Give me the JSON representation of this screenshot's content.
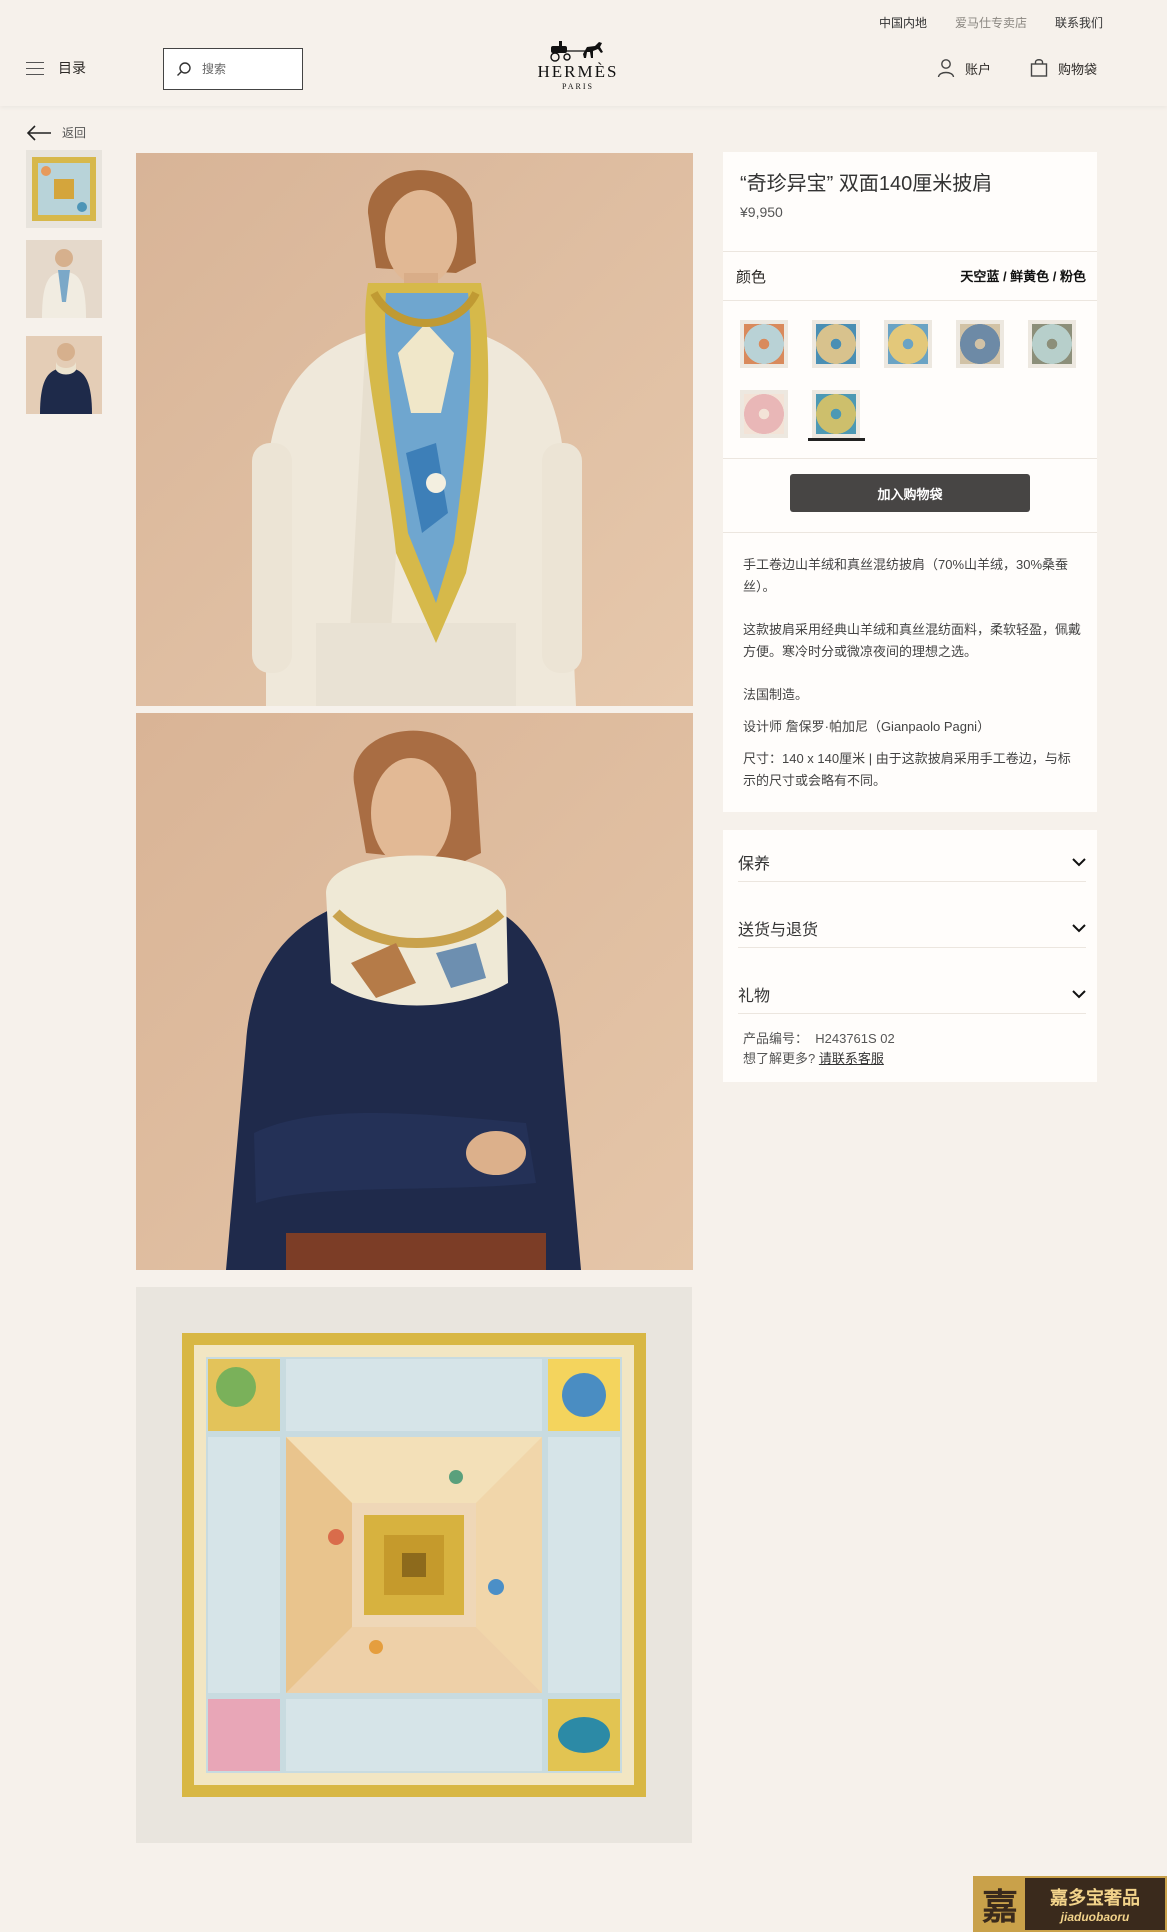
{
  "header": {
    "utility_links": [
      "中国内地",
      "爱马仕专卖店",
      "联系我们"
    ],
    "menu_label": "目录",
    "search_placeholder": "搜索",
    "logo_word": "HERMÈS",
    "logo_sub": "PARIS",
    "account_label": "账户",
    "bag_label": "购物袋"
  },
  "back_label": "返回",
  "product": {
    "title": "“奇珍异宝” 双面140厘米披肩",
    "price": "¥9,950",
    "color_label": "颜色",
    "color_value": "天空蓝 / 鲜黄色 / 粉色",
    "swatches": [
      {
        "bg": "#b9d2d6",
        "accent": "#d98a5c"
      },
      {
        "bg": "#d8c28d",
        "accent": "#4a8fb4"
      },
      {
        "bg": "#e3c87a",
        "accent": "#6aa3c4"
      },
      {
        "bg": "#6d8aa6",
        "accent": "#d1c2a6"
      },
      {
        "bg": "#b7cfcb",
        "accent": "#8c8f7a"
      },
      {
        "bg": "#e9b7b7",
        "accent": "#f3e3d7"
      },
      {
        "bg": "#cdbf6c",
        "accent": "#4d99b4"
      }
    ],
    "selected_swatch": 6,
    "add_to_bag": "加入购物袋",
    "description": [
      "手工卷边山羊绒和真丝混纺披肩（70%山羊绒，30%桑蚕丝）。",
      "这款披肩采用经典山羊绒和真丝混纺面料，柔软轻盈，佩戴方便。寒冷时分或微凉夜间的理想之选。",
      "法国制造。",
      "设计师 詹保罗·帕加尼（Gianpaolo Pagni）",
      "尺寸：140 x 140厘米 | 由于这款披肩采用手工卷边，与标示的尺寸或会略有不同。"
    ]
  },
  "accordion": [
    "保养",
    "送货与退货",
    "礼物"
  ],
  "meta": {
    "ref_label": "产品编号：",
    "ref_value": "H243761S 02",
    "more_label": "想了解更多?",
    "more_link": "请联系客服"
  },
  "watermark": {
    "seal": "嘉",
    "cn": "嘉多宝奢品",
    "en": "jiaduobaoru"
  },
  "colors": {
    "background": "#f6f1eb",
    "panel": "#fffdfb",
    "button": "#474544"
  }
}
